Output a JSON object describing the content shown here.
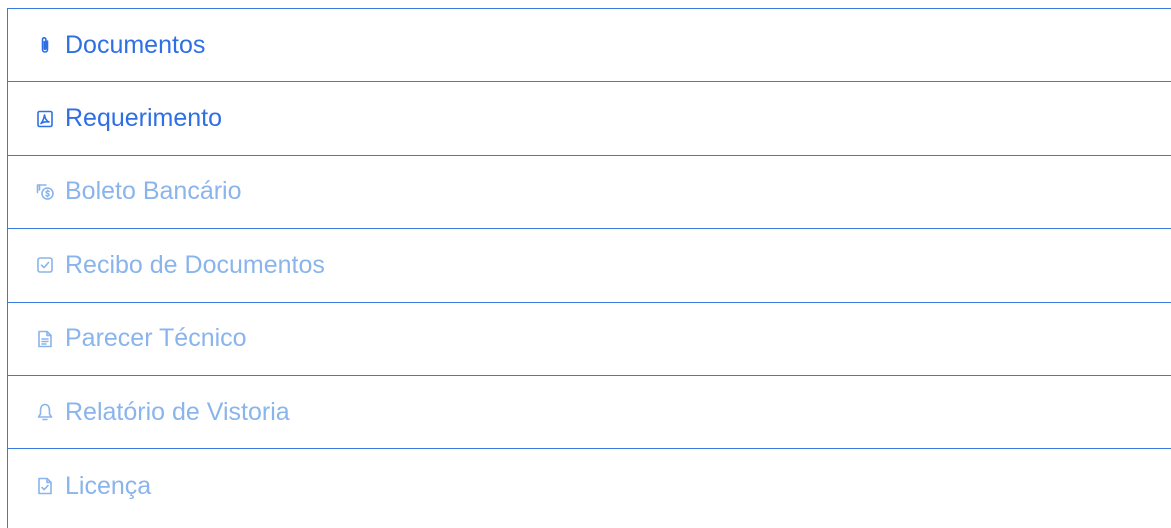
{
  "colors": {
    "border": "#3b7be0",
    "active_text": "#2f6fe4",
    "inactive_text": "#8ab4ec"
  },
  "menu": {
    "items": [
      {
        "label": "Documentos",
        "icon": "paperclip-icon",
        "state": "active"
      },
      {
        "label": "Requerimento",
        "icon": "pdf-file-icon",
        "state": "active"
      },
      {
        "label": "Boleto Bancário",
        "icon": "money-bill-icon",
        "state": "inactive"
      },
      {
        "label": "Recibo de Documentos",
        "icon": "check-square-icon",
        "state": "inactive"
      },
      {
        "label": "Parecer Técnico",
        "icon": "text-document-icon",
        "state": "inactive"
      },
      {
        "label": "Relatório de Vistoria",
        "icon": "bell-icon",
        "state": "inactive"
      },
      {
        "label": "Licença",
        "icon": "check-document-icon",
        "state": "inactive"
      }
    ]
  }
}
